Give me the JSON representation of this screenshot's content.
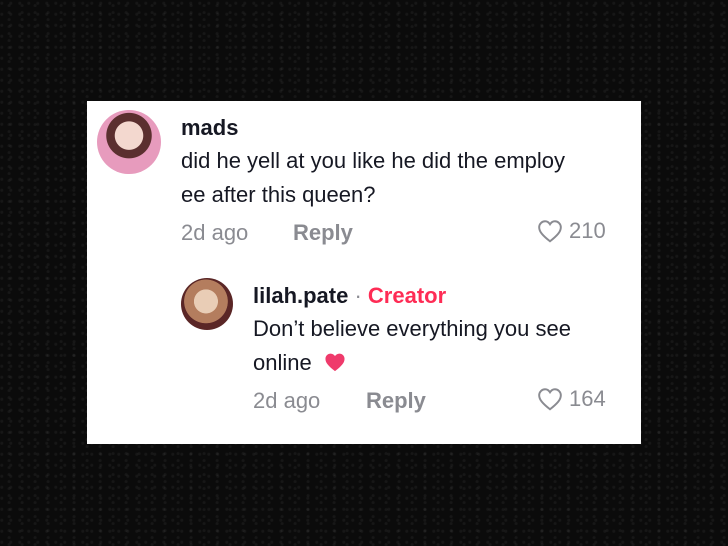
{
  "comments": [
    {
      "username": "mads",
      "text_line1": "did he yell at you like he did the employ",
      "text_line2": "ee after this queen?",
      "time": "2d ago",
      "reply_label": "Reply",
      "likes": "210"
    },
    {
      "username": "lilah.pate",
      "badge_sep": " · ",
      "badge": "Creator",
      "text_line1": "Don’t believe everything you see",
      "text_line2": "online",
      "time": "2d ago",
      "reply_label": "Reply",
      "likes": "164"
    }
  ],
  "colors": {
    "accent": "#fe2c55",
    "heart_emoji": "#ef3a6b",
    "muted": "#8a8b91"
  },
  "icons": [
    "heart-outline-icon",
    "heart-emoji-icon"
  ]
}
